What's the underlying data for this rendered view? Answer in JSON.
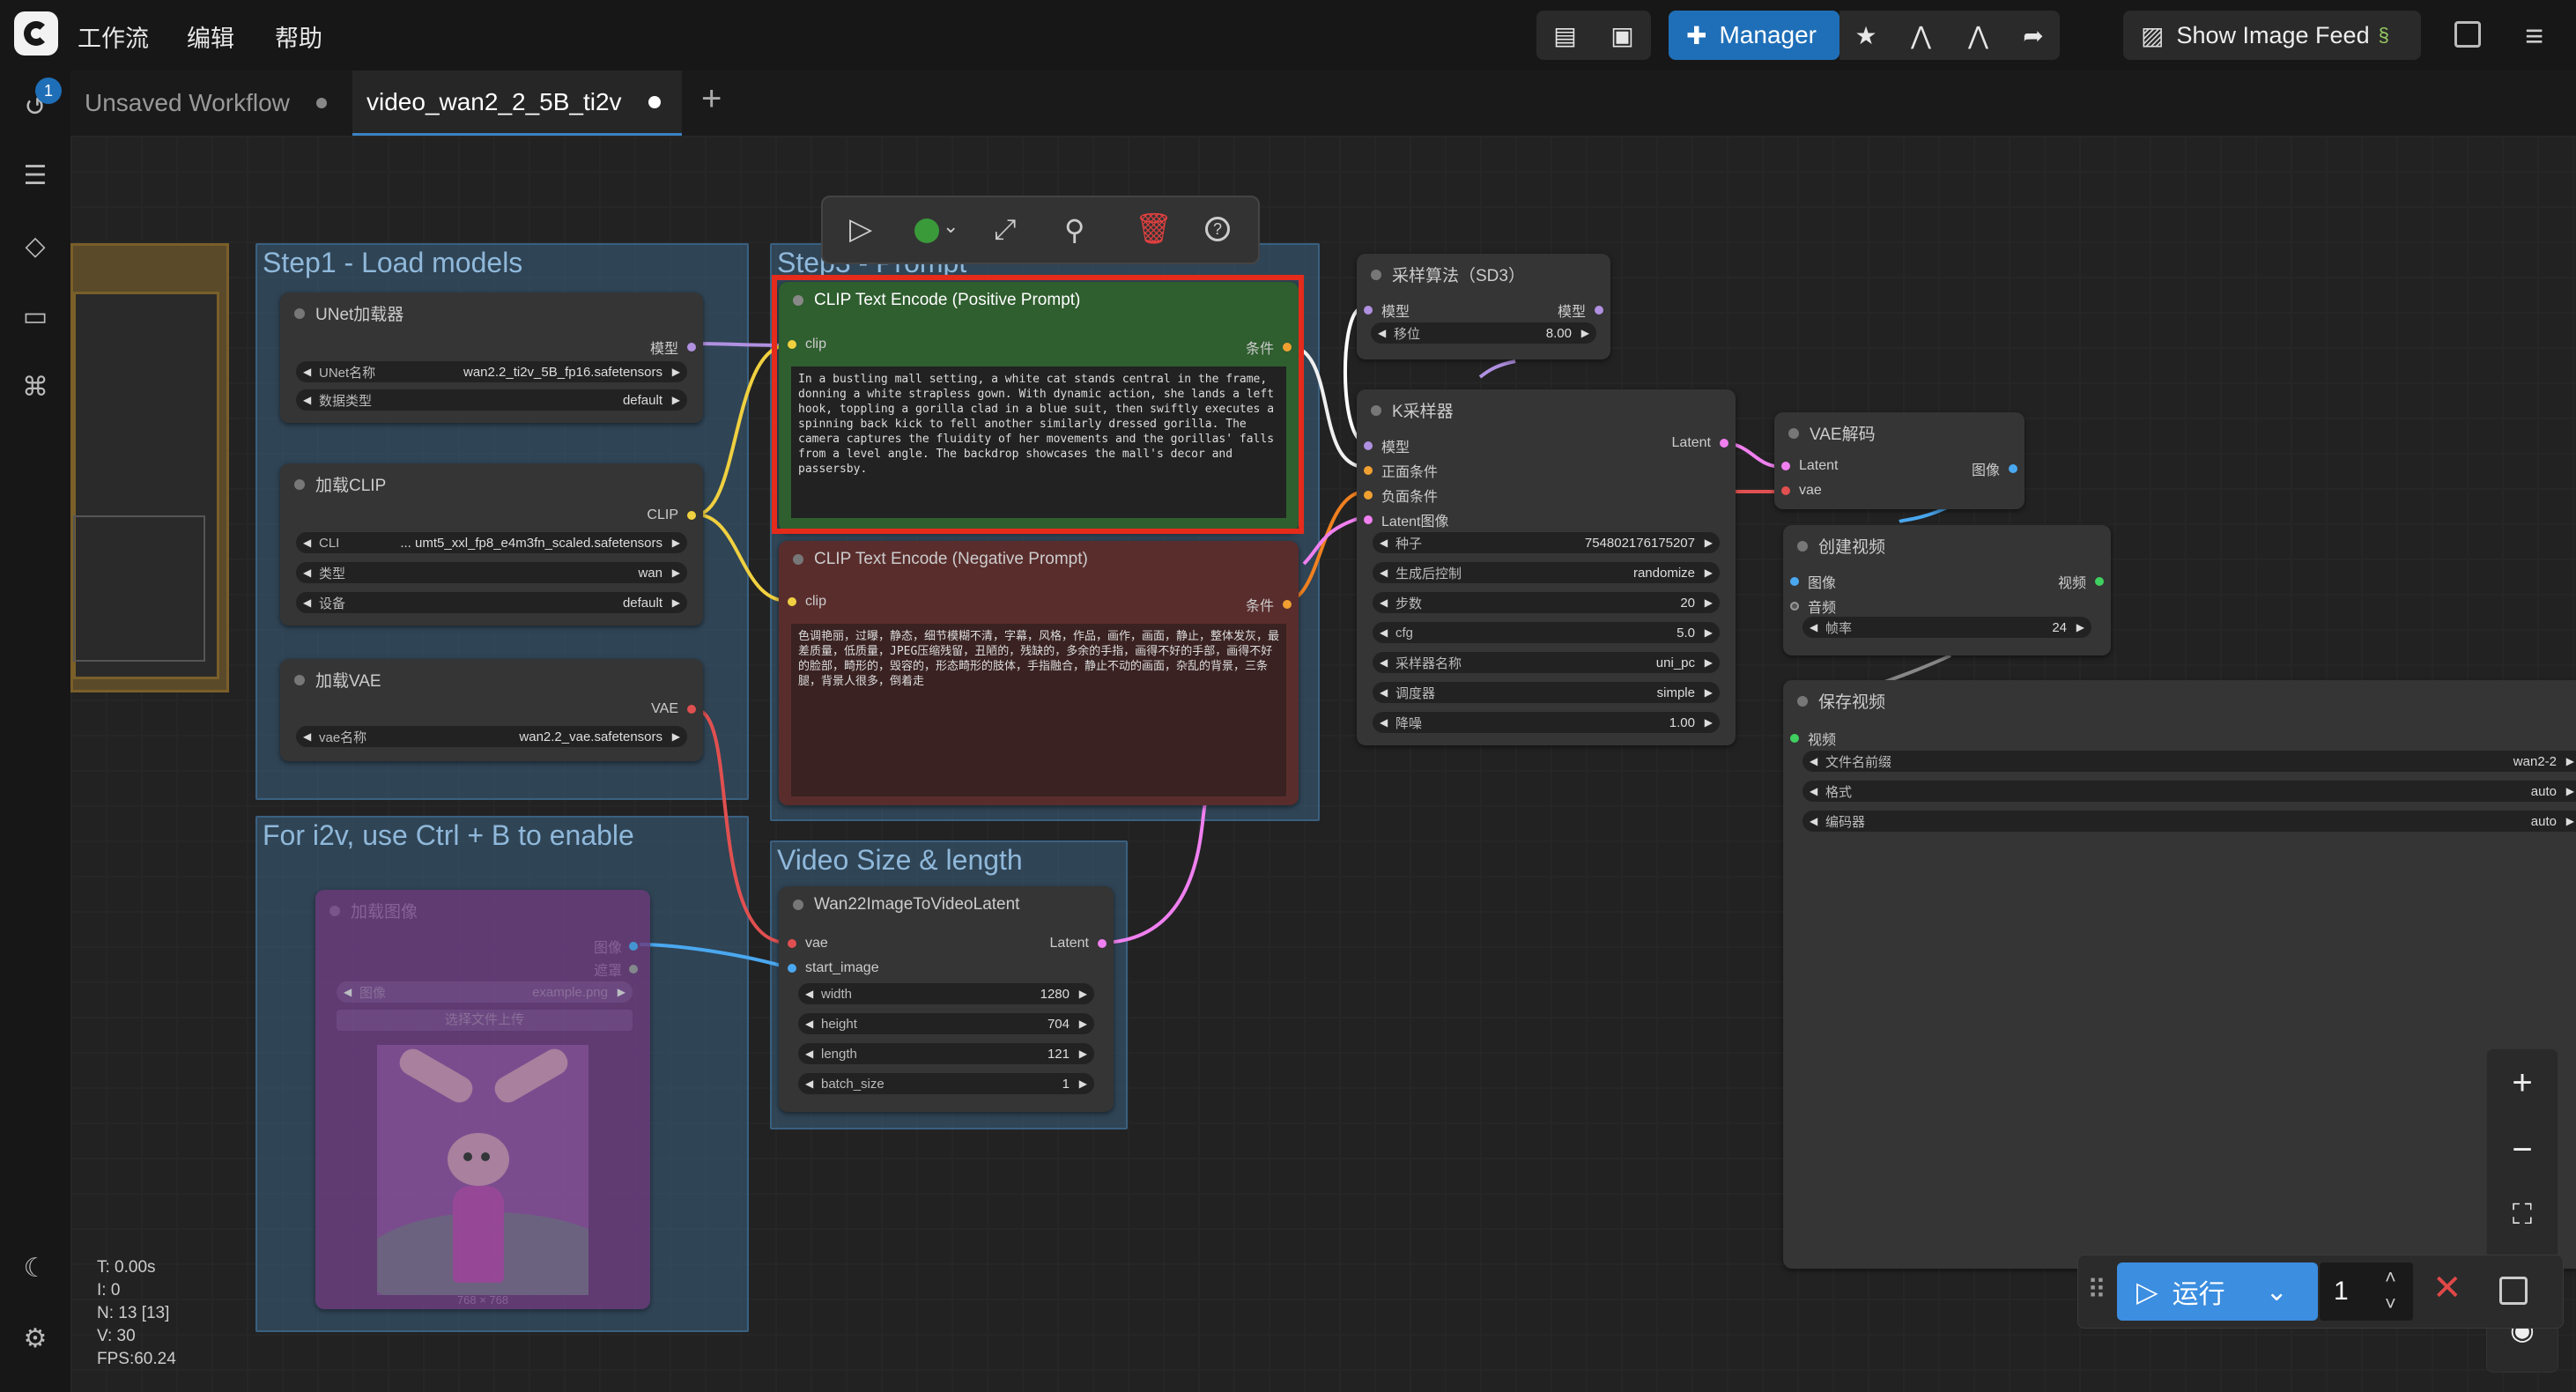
{
  "menu": [
    "工作流",
    "编辑",
    "帮助"
  ],
  "toolbar": {
    "manager_label": "Manager",
    "show_image_feed_label": "Show Image Feed"
  },
  "queue_badge": "1",
  "tabs": [
    {
      "label": "Unsaved Workflow"
    },
    {
      "label": "video_wan2_2_5B_ti2v"
    }
  ],
  "tab_add": "+",
  "groups": {
    "step1": "Step1 - Load models",
    "step3": "Step3 - Prompt",
    "i2v": "For i2v, use Ctrl + B to enable",
    "size": "Video Size & length"
  },
  "nodes": {
    "unet": {
      "title": "UNet加载器",
      "out": "模型",
      "w_name_label": "UNet名称",
      "w_name_value": "wan2.2_ti2v_5B_fp16.safetensors",
      "w_type_label": "数据类型",
      "w_type_value": "default"
    },
    "clip": {
      "title": "加载CLIP",
      "out": "CLIP",
      "w1_label": "CLI",
      "w1_value": "... umt5_xxl_fp8_e4m3fn_scaled.safetensors",
      "w2_label": "类型",
      "w2_value": "wan",
      "w3_label": "设备",
      "w3_value": "default"
    },
    "vae": {
      "title": "加载VAE",
      "out": "VAE",
      "w_label": "vae名称",
      "w_value": "wan2.2_vae.safetensors"
    },
    "load_image": {
      "title": "加载图像",
      "out1": "图像",
      "out2": "遮罩",
      "w_label": "图像",
      "w_value": "example.png",
      "upload": "选择文件上传",
      "size_caption": "768 × 768"
    },
    "pos": {
      "title": "CLIP Text Encode (Positive Prompt)",
      "in": "clip",
      "out": "条件",
      "text": "In a bustling mall setting, a white cat stands central in the frame, donning a white strapless gown. With dynamic action, she lands a left hook, toppling a gorilla clad in a blue suit, then swiftly executes a spinning back kick to fell another similarly dressed gorilla. The camera captures the fluidity of her movements and the gorillas' falls from a level angle. The backdrop showcases the mall's decor and passersby."
    },
    "neg": {
      "title": "CLIP Text Encode (Negative Prompt)",
      "in": "clip",
      "out": "条件",
      "text": "色调艳丽，过曝，静态，细节模糊不清，字幕，风格，作品，画作，画面，静止，整体发灰，最差质量，低质量，JPEG压缩残留，丑陋的，残缺的，多余的手指，画得不好的手部，画得不好的脸部，畸形的，毁容的，形态畸形的肢体，手指融合，静止不动的画面，杂乱的背景，三条腿，背景人很多，倒着走"
    },
    "wan": {
      "title": "Wan22ImageToVideoLatent",
      "in1": "vae",
      "in2": "start_image",
      "out": "Latent",
      "widgets": [
        {
          "label": "width",
          "value": "1280"
        },
        {
          "label": "height",
          "value": "704"
        },
        {
          "label": "length",
          "value": "121"
        },
        {
          "label": "batch_size",
          "value": "1"
        }
      ]
    },
    "sampling": {
      "title": "采样算法（SD3）",
      "in": "模型",
      "out": "模型",
      "w_label": "移位",
      "w_value": "8.00"
    },
    "ksampler": {
      "title": "K采样器",
      "in": [
        "模型",
        "正面条件",
        "负面条件",
        "Latent图像"
      ],
      "out": "Latent",
      "widgets": [
        {
          "label": "种子",
          "value": "754802176175207"
        },
        {
          "label": "生成后控制",
          "value": "randomize"
        },
        {
          "label": "步数",
          "value": "20"
        },
        {
          "label": "cfg",
          "value": "5.0"
        },
        {
          "label": "采样器名称",
          "value": "uni_pc"
        },
        {
          "label": "调度器",
          "value": "simple"
        },
        {
          "label": "降噪",
          "value": "1.00"
        }
      ]
    },
    "vaedecode": {
      "title": "VAE解码",
      "in1": "Latent",
      "in2": "vae",
      "out": "图像"
    },
    "createvideo": {
      "title": "创建视频",
      "in1": "图像",
      "in2": "音频",
      "out": "视频",
      "w_label": "帧率",
      "w_value": "24"
    },
    "savevideo": {
      "title": "保存视频",
      "in": "视频",
      "widgets": [
        {
          "label": "文件名前缀",
          "value": "wan2-2"
        },
        {
          "label": "格式",
          "value": "auto"
        },
        {
          "label": "编码器",
          "value": "auto"
        }
      ]
    }
  },
  "stats": [
    "T: 0.00s",
    "I: 0",
    "N: 13 [13]",
    "V: 30",
    "FPS:60.24"
  ],
  "run": {
    "label": "运行",
    "count": "1"
  },
  "colors": {
    "accent": "#1f6fb8",
    "highlight": "#e52b1b",
    "pos_node": "#2f5e2f",
    "neg_node": "#5a2d2d",
    "group_blue": "#3a6080",
    "group_purple": "#6b3a7a"
  }
}
